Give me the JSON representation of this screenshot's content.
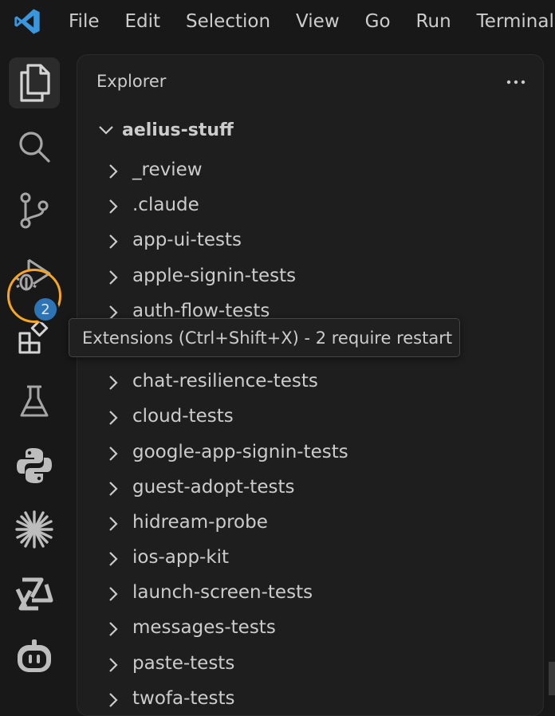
{
  "menu": {
    "items": [
      "File",
      "Edit",
      "Selection",
      "View",
      "Go",
      "Run",
      "Terminal"
    ]
  },
  "activity_bar": {
    "items": [
      {
        "name": "explorer",
        "icon": "files-icon",
        "active": true
      },
      {
        "name": "search",
        "icon": "search-icon"
      },
      {
        "name": "source-control",
        "icon": "source-control-icon"
      },
      {
        "name": "run-debug",
        "icon": "run-debug-icon"
      },
      {
        "name": "extensions",
        "icon": "extensions-icon"
      },
      {
        "name": "testing",
        "icon": "flask-icon"
      },
      {
        "name": "python",
        "icon": "python-icon"
      },
      {
        "name": "claude",
        "icon": "starburst-icon"
      },
      {
        "name": "copilot-agent",
        "icon": "triangle-knot-icon"
      },
      {
        "name": "chat",
        "icon": "robot-icon"
      }
    ],
    "extensions_badge": "2"
  },
  "explorer": {
    "title": "Explorer",
    "more_actions_icon": "ellipsis-icon",
    "root_folder": "aelius-stuff",
    "folders": [
      "_review",
      ".claude",
      "app-ui-tests",
      "apple-signin-tests",
      "auth-flow-tests",
      "",
      "chat-resilience-tests",
      "cloud-tests",
      "google-app-signin-tests",
      "guest-adopt-tests",
      "hidream-probe",
      "ios-app-kit",
      "launch-screen-tests",
      "messages-tests",
      "paste-tests",
      "twofa-tests"
    ]
  },
  "tooltip": {
    "text": "Extensions (Ctrl+Shift+X) - 2 require restart"
  },
  "colors": {
    "background": "#181818",
    "sidebar": "#1e1e1e",
    "accent_ring": "#f5a623",
    "badge": "#2d74b6",
    "vscode_blue": "#3a96dd"
  }
}
